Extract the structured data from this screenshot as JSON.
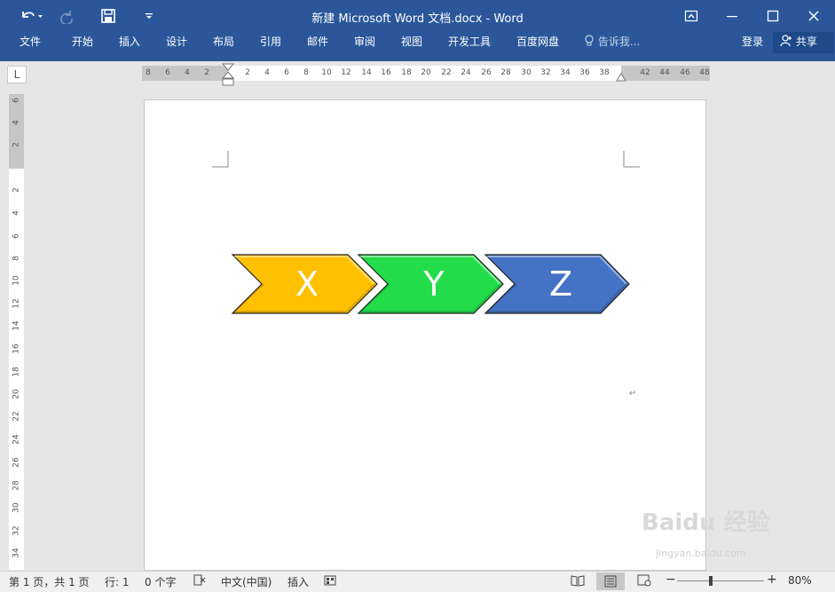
{
  "window": {
    "title": "新建 Microsoft Word 文档.docx - Word"
  },
  "quick_access": {
    "undo_icon": "undo-icon",
    "redo_icon": "redo-icon",
    "save_icon": "save-icon",
    "customize_icon": "customize-qat-icon"
  },
  "window_controls": {
    "ribbon_display_icon": "ribbon-display-icon",
    "minimize_icon": "minimize-icon",
    "maximize_icon": "maximize-icon",
    "close_icon": "close-icon"
  },
  "menu": {
    "items": [
      "文件",
      "开始",
      "插入",
      "设计",
      "布局",
      "引用",
      "邮件",
      "审阅",
      "视图",
      "开发工具",
      "百度网盘"
    ],
    "tell_me": "告诉我...",
    "login": "登录",
    "share": "共享"
  },
  "ruler": {
    "tab_selector": "L",
    "horizontal_ticks": [
      "8",
      "6",
      "4",
      "2",
      "2",
      "4",
      "6",
      "8",
      "10",
      "12",
      "14",
      "16",
      "18",
      "20",
      "22",
      "24",
      "26",
      "28",
      "30",
      "32",
      "34",
      "36",
      "38",
      "42",
      "44",
      "46",
      "48"
    ],
    "vertical_ticks": [
      "6",
      "4",
      "2",
      "2",
      "4",
      "6",
      "8",
      "10",
      "12",
      "14",
      "16",
      "18",
      "20",
      "22",
      "24",
      "26",
      "28",
      "30",
      "32",
      "34"
    ]
  },
  "document": {
    "chevrons": [
      {
        "label": "X",
        "color": "#ffc000"
      },
      {
        "label": "Y",
        "color": "#22dc4a"
      },
      {
        "label": "Z",
        "color": "#4472c4"
      }
    ],
    "paragraph_mark": "↵"
  },
  "statusbar": {
    "page": "第 1 页，共 1 页",
    "line": "行: 1",
    "words": "0 个字",
    "language": "中文(中国)",
    "mode": "插入",
    "zoom": "80%"
  },
  "watermark": {
    "brand": "Baidu 经验",
    "url": "jingyan.baidu.com"
  }
}
